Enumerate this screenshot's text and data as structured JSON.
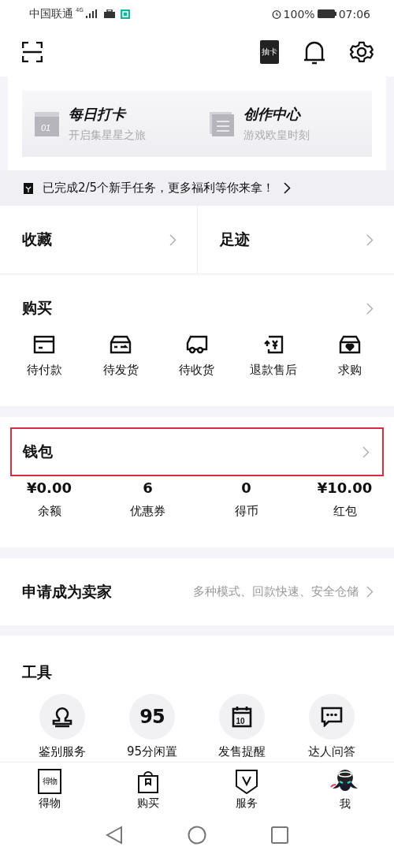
{
  "status_bar": {
    "carrier": "中国联通",
    "network": "4G",
    "battery": "100%",
    "time": "07:06"
  },
  "header": {
    "badge_text": "抽卡"
  },
  "feature_cards": [
    {
      "kind": "calendar",
      "title": "每日打卡",
      "subtitle": "开启集星星之旅",
      "icon_text": "01"
    },
    {
      "kind": "document",
      "title": "创作中心",
      "subtitle": "游戏欧皇时刻"
    }
  ],
  "task_banner": {
    "text": "已完成2/5个新手任务，更多福利等你来拿！"
  },
  "quick_links": [
    {
      "label": "收藏"
    },
    {
      "label": "足迹"
    }
  ],
  "purchase": {
    "title": "购买",
    "items": [
      {
        "kind": "card",
        "label": "待付款"
      },
      {
        "kind": "box",
        "label": "待发货"
      },
      {
        "kind": "truck",
        "label": "待收货"
      },
      {
        "kind": "refund",
        "label": "退款售后"
      },
      {
        "kind": "heart-box",
        "label": "求购"
      }
    ]
  },
  "wallet": {
    "title": "钱包",
    "highlighted": true,
    "items": [
      {
        "value": "¥0.00",
        "label": "余额"
      },
      {
        "value": "6",
        "label": "优惠券"
      },
      {
        "value": "0",
        "label": "得币"
      },
      {
        "value": "¥10.00",
        "label": "红包"
      }
    ]
  },
  "seller": {
    "title": "申请成为卖家",
    "subtitle": "多种模式、回款快速、安全仓储"
  },
  "tools": {
    "title": "工具",
    "items": [
      {
        "kind": "stamp",
        "label": "鉴别服务"
      },
      {
        "kind": "text",
        "label": "95分闲置",
        "icon_text": "95"
      },
      {
        "kind": "calendar",
        "label": "发售提醒",
        "icon_text": "10"
      },
      {
        "kind": "chat",
        "label": "达人问答"
      }
    ]
  },
  "tab_bar": [
    {
      "kind": "logo",
      "label": "得物",
      "icon_text": "得物"
    },
    {
      "kind": "bag",
      "label": "购买"
    },
    {
      "kind": "shield",
      "label": "服务"
    },
    {
      "kind": "avatar",
      "label": "我"
    }
  ]
}
